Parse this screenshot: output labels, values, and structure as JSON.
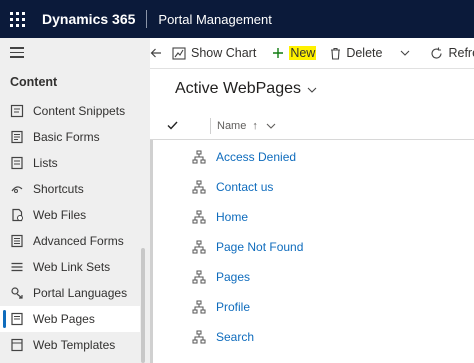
{
  "header": {
    "brand": "Dynamics 365",
    "app": "Portal Management"
  },
  "sidebar": {
    "group": "Content",
    "items": [
      {
        "label": "Content Snippets",
        "icon": "snippet-icon"
      },
      {
        "label": "Basic Forms",
        "icon": "form-icon"
      },
      {
        "label": "Lists",
        "icon": "list-icon"
      },
      {
        "label": "Shortcuts",
        "icon": "shortcut-icon"
      },
      {
        "label": "Web Files",
        "icon": "file-icon"
      },
      {
        "label": "Advanced Forms",
        "icon": "advanced-form-icon"
      },
      {
        "label": "Web Link Sets",
        "icon": "link-set-icon"
      },
      {
        "label": "Portal Languages",
        "icon": "language-icon"
      },
      {
        "label": "Web Pages",
        "icon": "web-page-icon",
        "selected": true
      },
      {
        "label": "Web Templates",
        "icon": "template-icon"
      }
    ]
  },
  "commandbar": {
    "show_chart": "Show Chart",
    "new": "New",
    "delete": "Delete",
    "refresh": "Refre"
  },
  "view": {
    "title": "Active WebPages",
    "column": "Name",
    "sort_indicator": "↑",
    "rows": [
      "Access Denied",
      "Contact us",
      "Home",
      "Page Not Found",
      "Pages",
      "Profile",
      "Search"
    ]
  },
  "colors": {
    "topbar": "#0b1a3a",
    "link": "#0f6cbd",
    "highlight": "#fff100",
    "selection": "#0f6cbd"
  }
}
